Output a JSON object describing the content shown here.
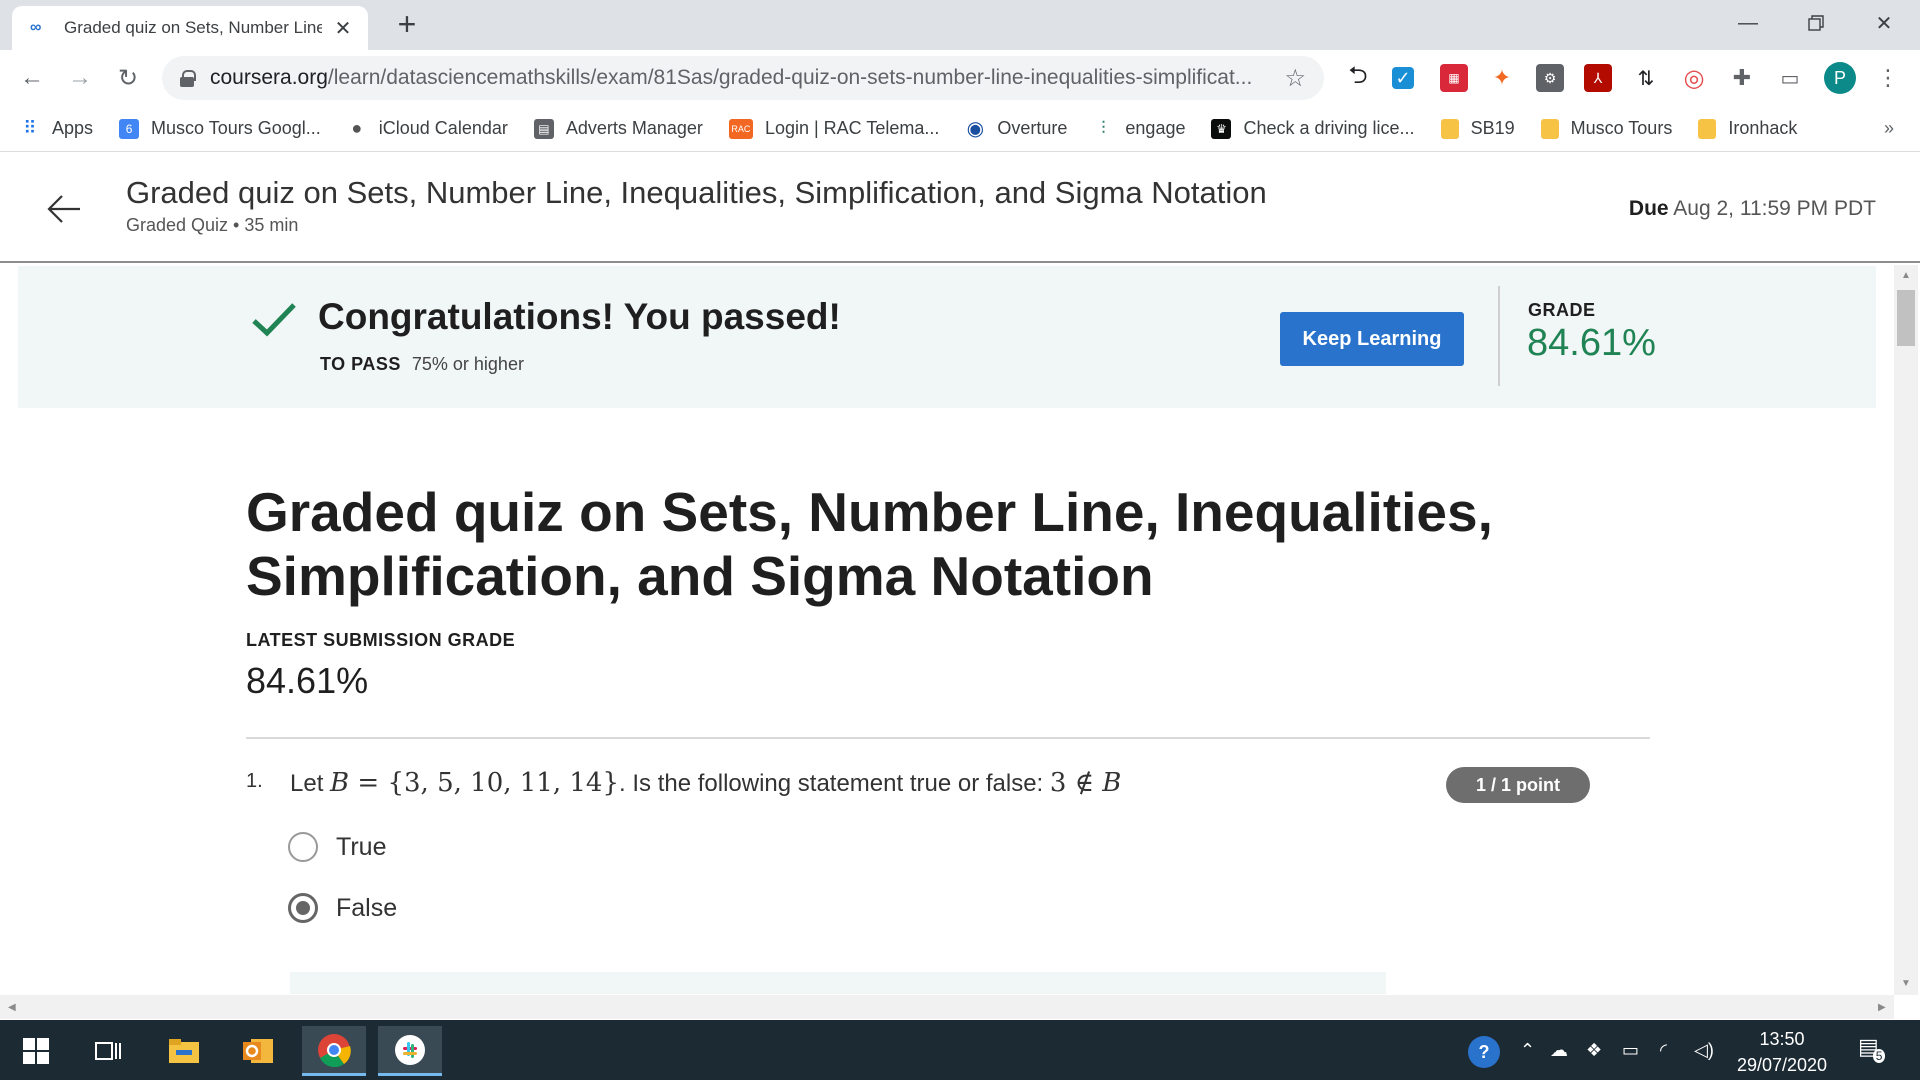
{
  "browser": {
    "tab_title": "Graded quiz on Sets, Number Line, Inequalities, Simplification, and Sigma Notation",
    "url_host": "coursera.org",
    "url_path": "/learn/datasciencemathskills/exam/81Sas/graded-quiz-on-sets-number-line-inequalities-simplificat...",
    "bookmarks": [
      {
        "label": "Apps",
        "icon": "apps-grid-icon",
        "color": "#1a73e8"
      },
      {
        "label": "Musco Tours Googl...",
        "icon": "google-calendar-icon",
        "color": "#4285f4"
      },
      {
        "label": "iCloud Calendar",
        "icon": "apple-icon",
        "color": "#555555"
      },
      {
        "label": "Adverts Manager",
        "icon": "adverts-icon",
        "color": "#5f6368"
      },
      {
        "label": "Login | RAC Telema...",
        "icon": "rac-icon",
        "color": "#f26722"
      },
      {
        "label": "Overture",
        "icon": "overture-icon",
        "color": "#1a4fa0"
      },
      {
        "label": "engage",
        "icon": "engage-icon",
        "color": "#2e7d6b"
      },
      {
        "label": "Check a driving lice...",
        "icon": "gov-crown-icon",
        "color": "#0b0c0c"
      },
      {
        "label": "SB19",
        "icon": "folder-icon",
        "color": "#f6c344"
      },
      {
        "label": "Musco Tours",
        "icon": "folder-icon",
        "color": "#f6c344"
      },
      {
        "label": "Ironhack",
        "icon": "folder-icon",
        "color": "#f6c344"
      }
    ],
    "bookmarks_more": "»",
    "profile_initial": "P"
  },
  "header": {
    "title": "Graded quiz on Sets, Number Line, Inequalities, Simplification, and Sigma Notation",
    "subtitle": "Graded Quiz • 35 min",
    "due_label": "Due",
    "due_value": "Aug 2, 11:59 PM PDT"
  },
  "banner": {
    "heading": "Congratulations! You passed!",
    "to_pass_label": "TO PASS",
    "to_pass_value": "75% or higher",
    "button": "Keep Learning",
    "grade_label": "GRADE",
    "grade_value": "84.61%",
    "pass_color": "#1f8354"
  },
  "main": {
    "title": "Graded quiz on Sets, Number Line, Inequalities, Simplification, and Sigma Notation",
    "latest_label": "LATEST SUBMISSION GRADE",
    "latest_value": "84.61%",
    "question": {
      "number": "1.",
      "prefix": "Let",
      "set_var": "B",
      "set_expr": "= {3, 5, 10, 11, 14}",
      "middle": ". Is the following statement true or false:",
      "statement_num": "3",
      "statement_op": "∉",
      "statement_var": "B",
      "points": "1 / 1 point",
      "options": [
        {
          "label": "True",
          "selected": false
        },
        {
          "label": "False",
          "selected": true
        }
      ]
    }
  },
  "taskbar": {
    "time": "13:50",
    "date": "29/07/2020",
    "notification_count": "5"
  }
}
